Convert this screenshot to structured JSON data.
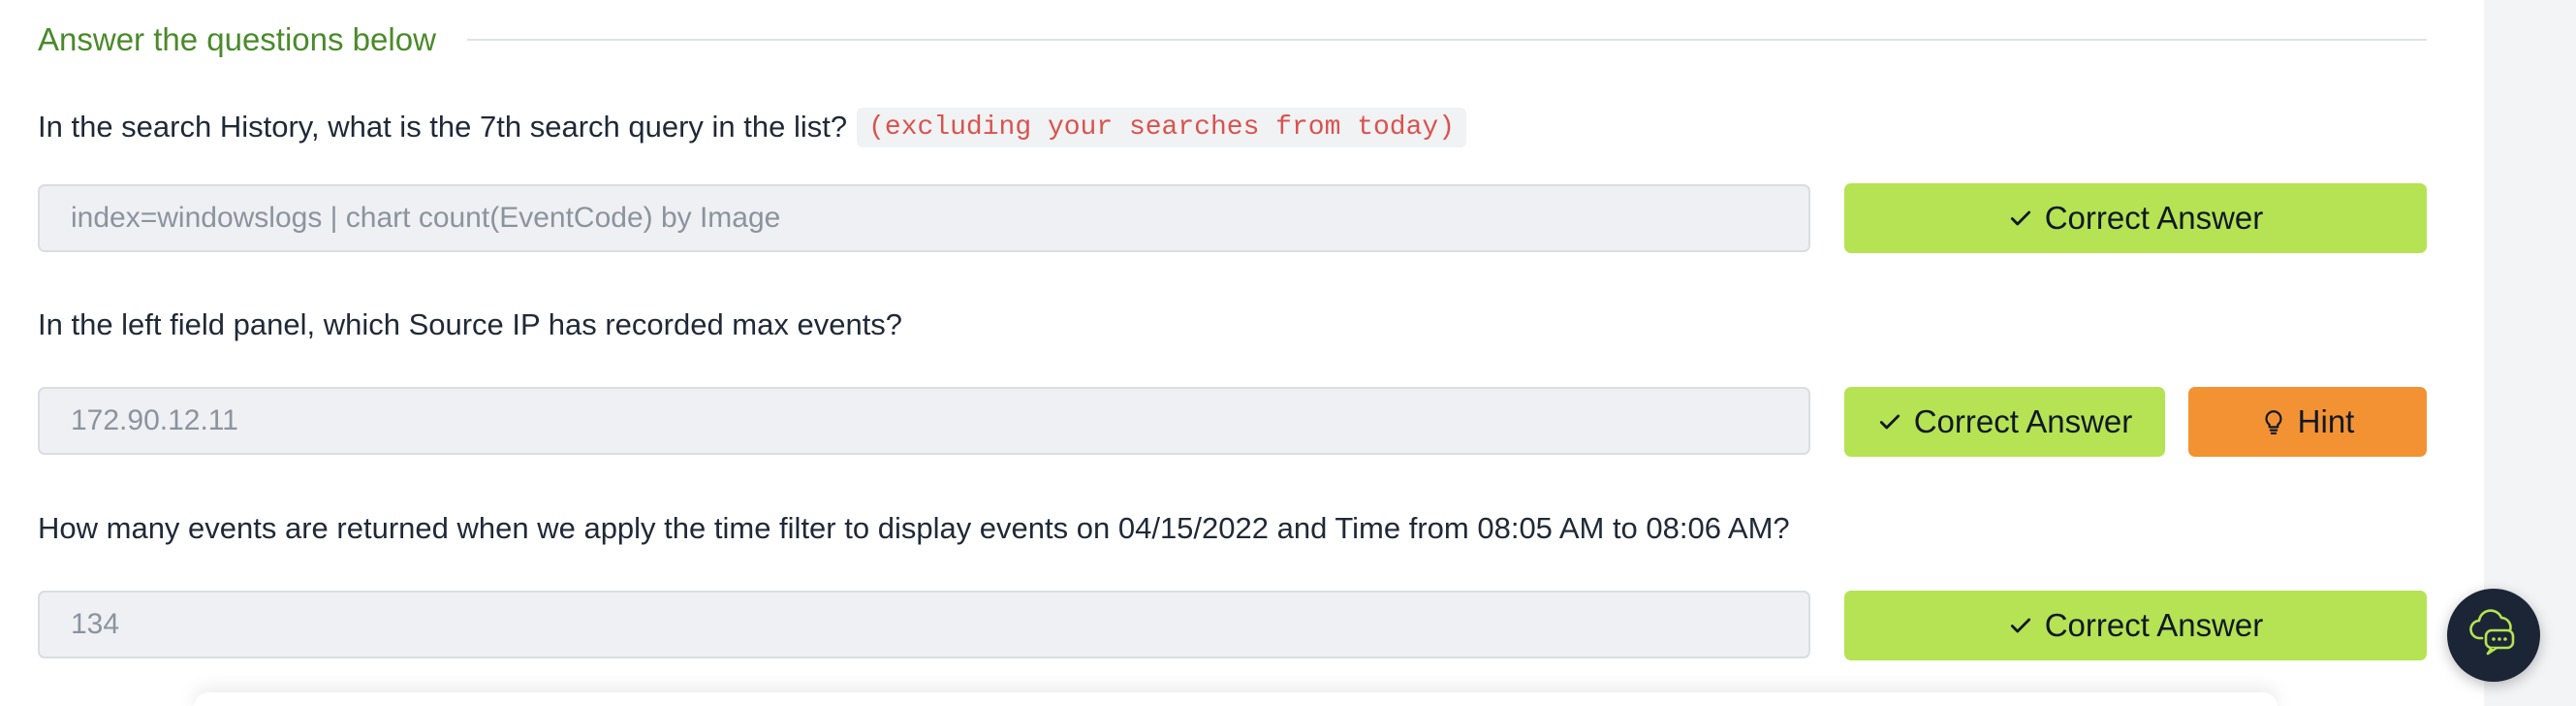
{
  "section": {
    "title": "Answer the questions below"
  },
  "questions": [
    {
      "text": "In the search History, what is the 7th search query in the list?",
      "note": "(excluding your searches from today)",
      "answer": "index=windowslogs | chart count(EventCode) by Image",
      "correct_label": "Correct Answer"
    },
    {
      "text": "In the left field panel, which Source IP has recorded max events?",
      "answer": "172.90.12.11",
      "correct_label": "Correct Answer",
      "hint_label": "Hint"
    },
    {
      "text": "How many events are returned when we apply the time filter to display events on 04/15/2022 and Time from 08:05 AM to 08:06 AM?",
      "answer": "134",
      "correct_label": "Correct Answer"
    }
  ],
  "icons": {
    "check": "check-icon",
    "hint": "lightbulb-icon",
    "chat": "chat-cloud-icon"
  },
  "colors": {
    "section_title": "#4a8a2a",
    "correct_button": "#b5e353",
    "hint_button": "#f39233",
    "code_text": "#d9534f",
    "chat_button": "#1c2536"
  }
}
